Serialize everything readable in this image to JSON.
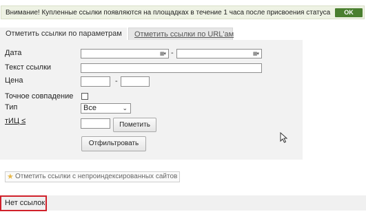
{
  "notice": {
    "text": "Внимание! Купленные ссылки появляются на площадках в течение 1 часа после присвоения статуса",
    "ok_label": "OK"
  },
  "tabs": [
    {
      "label": "Отметить ссылки по параметрам",
      "active": true
    },
    {
      "label": "Отметить ссылки по URL'ам",
      "active": false
    }
  ],
  "filter": {
    "date_label": "Дата",
    "date_from_value": "",
    "date_to_value": "",
    "date_separator": "-",
    "link_text_label": "Текст ссылки",
    "link_text_value": "",
    "price_label": "Цена",
    "price_from_value": "",
    "price_to_value": "",
    "price_separator": "-",
    "exact_match_label": "Точное совпадение",
    "exact_match_checked": false,
    "type_label": "Тип",
    "type_selected": "Все",
    "tic_label": "тИЦ ≤",
    "tic_value": "",
    "mark_button": "Пометить",
    "filter_button": "Отфильтровать"
  },
  "mark_unindexed_button": "Отметить ссылки с непроиндексированных сайтов",
  "no_links_text": "Нет ссылок",
  "icons": {
    "calendar": "calendar-icon",
    "dropdown": "chevron-down-icon",
    "star": "star-icon",
    "cursor": "mouse-cursor-icon"
  },
  "colors": {
    "ok_button": "#4a7f2f",
    "highlight_border": "#d0202a",
    "panel_bg": "#f2f2f2"
  }
}
